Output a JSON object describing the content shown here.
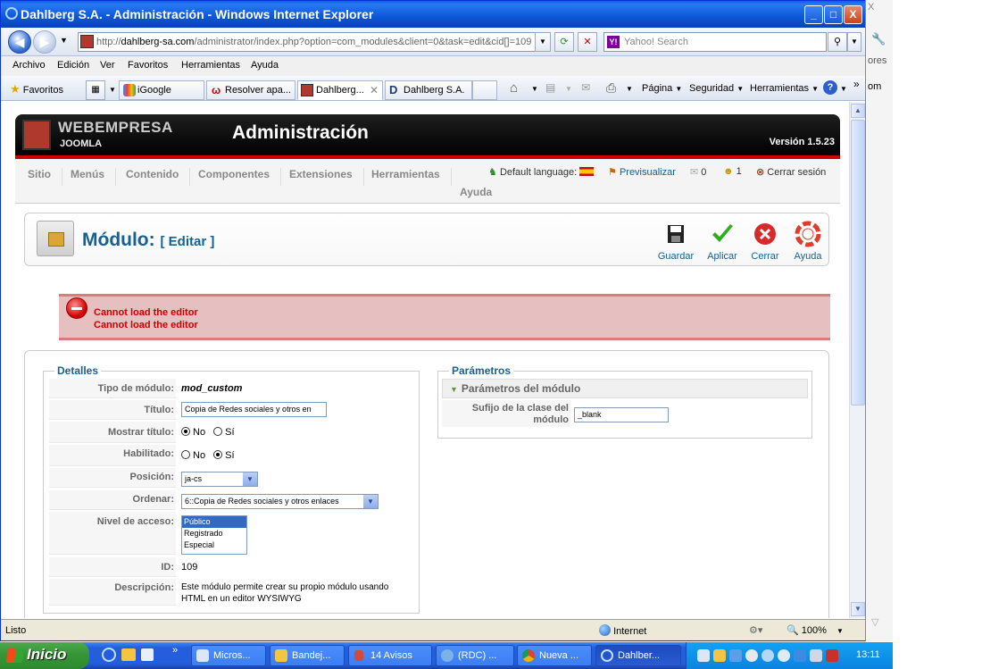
{
  "window": {
    "title": "Dahlberg S.A. - Administración - Windows Internet Explorer",
    "minimize": "_",
    "maximize": "□",
    "close": "X"
  },
  "address_bar": {
    "url_prefix": "http://",
    "url_domain": "dahlberg-sa.com",
    "url_path": "/administrator/index.php?option=com_modules&client=0&task=edit&cid[]=109",
    "search_placeholder": "Yahoo! Search"
  },
  "menu": [
    "Archivo",
    "Edición",
    "Ver",
    "Favoritos",
    "Herramientas",
    "Ayuda"
  ],
  "favorites_bar": {
    "favorites_label": "Favoritos",
    "tabs": [
      "iGoogle",
      "Resolver apa...",
      "Dahlberg...",
      "Dahlberg S.A."
    ],
    "tools": [
      "Página",
      "Seguridad",
      "Herramientas"
    ]
  },
  "joomla": {
    "logo_main": "WEBEMPRESA",
    "logo_sub": "JOOMLA",
    "header_title": "Administración",
    "version": "Versión 1.5.23",
    "menu": [
      "Sitio",
      "Menús",
      "Contenido",
      "Componentes",
      "Extensiones",
      "Herramientas"
    ],
    "menu_help": "Ayuda",
    "default_language_label": "Default language:",
    "preview": "Previsualizar",
    "messages_count": "0",
    "users_count": "1",
    "logout": "Cerrar sesión"
  },
  "toolbar": {
    "title": "Módulo:",
    "title_action": "[ Editar ]",
    "save": "Guardar",
    "apply": "Aplicar",
    "close": "Cerrar",
    "help": "Ayuda"
  },
  "errors": [
    "Cannot load the editor",
    "Cannot load the editor"
  ],
  "details": {
    "legend": "Detalles",
    "module_type_label": "Tipo de módulo:",
    "module_type": "mod_custom",
    "title_label": "Título:",
    "title_value": "Copia de Redes sociales y otros en",
    "show_title_label": "Mostrar título:",
    "enabled_label": "Habilitado:",
    "no": "No",
    "yes": "Sí",
    "position_label": "Posición:",
    "position_value": "ja-cs",
    "order_label": "Ordenar:",
    "order_value": "6::Copia de Redes sociales y otros enlaces",
    "access_label": "Nivel de acceso:",
    "access_options": [
      "Público",
      "Registrado",
      "Especial"
    ],
    "id_label": "ID:",
    "id_value": "109",
    "description_label": "Descripción:",
    "description_line1": "Este módulo permite crear su propio módulo usando",
    "description_line2": "HTML en un editor WYSIWYG"
  },
  "parameters": {
    "legend": "Parámetros",
    "section": "Parámetros del módulo",
    "suffix_label_line1": "Sufijo de la clase del",
    "suffix_label_line2": "módulo",
    "suffix_value": "_blank"
  },
  "status_bar": {
    "status": "Listo",
    "zone": "Internet",
    "zoom": "100%"
  },
  "taskbar": {
    "start": "Inicio",
    "tasks": [
      "Micros...",
      "Bandej...",
      "14 Avisos",
      "(RDC) ...",
      "Nueva ...",
      "Dahlber..."
    ],
    "clock": "13:11"
  },
  "bg_window": {
    "text1": "ores",
    "text2": "om"
  },
  "colors": {
    "joomla_blue": "#146295",
    "error_red": "#cc0000",
    "header_red": "#cc0000",
    "xp_blue": "#245edc"
  }
}
